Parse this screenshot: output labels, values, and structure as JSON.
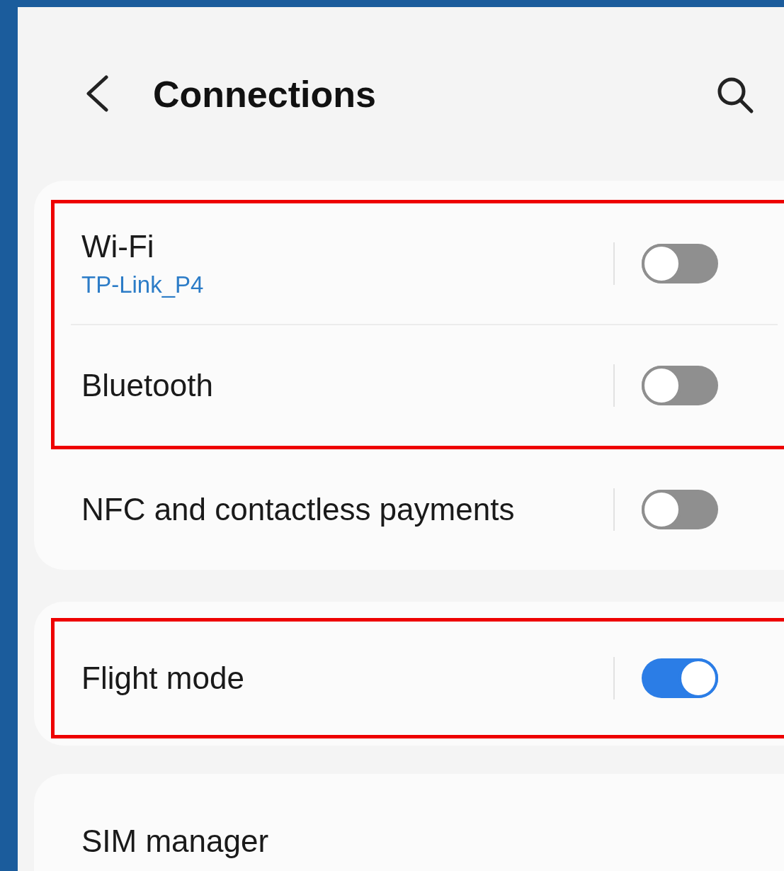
{
  "header": {
    "title": "Connections"
  },
  "cards": [
    {
      "rows": [
        {
          "label": "Wi-Fi",
          "subtitle": "TP-Link_P4",
          "toggle": {
            "on": false
          },
          "outlined": true
        },
        {
          "label": "Bluetooth",
          "toggle": {
            "on": false
          },
          "outlined": true
        },
        {
          "label": "NFC and contactless payments",
          "toggle": {
            "on": false
          },
          "outlined": false
        }
      ]
    },
    {
      "rows": [
        {
          "label": "Flight mode",
          "toggle": {
            "on": true
          },
          "outlined": true
        }
      ]
    },
    {
      "rows": [
        {
          "label": "SIM manager",
          "outlined": false
        }
      ]
    }
  ]
}
